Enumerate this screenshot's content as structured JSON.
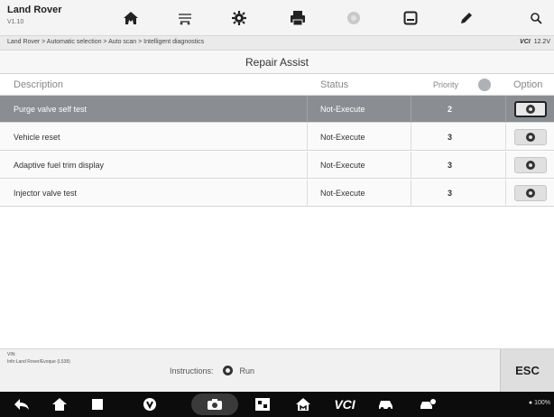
{
  "app": {
    "title": "Land Rover",
    "version": "V1.10"
  },
  "toolbar": {
    "buttons": [
      {
        "name": "home-icon"
      },
      {
        "name": "vehicle-swap-icon"
      },
      {
        "name": "settings-icon"
      },
      {
        "name": "print-icon"
      },
      {
        "name": "help-icon"
      },
      {
        "name": "save-icon"
      },
      {
        "name": "edit-icon"
      },
      {
        "name": "search-icon"
      }
    ]
  },
  "breadcrumb": {
    "path": "Land Rover > Automatic selection > Auto scan > Intelligent diagnostics",
    "vci_label": "VCI",
    "voltage": "12.2V"
  },
  "panel": {
    "title": "Repair Assist"
  },
  "table": {
    "headers": {
      "description": "Description",
      "status": "Status",
      "priority": "Priority",
      "option": "Option"
    },
    "rows": [
      {
        "description": "Purge valve self test",
        "status": "Not-Execute",
        "priority": "2",
        "selected": true
      },
      {
        "description": "Vehicle reset",
        "status": "Not-Execute",
        "priority": "3",
        "selected": false
      },
      {
        "description": "Adaptive fuel trim display",
        "status": "Not-Execute",
        "priority": "3",
        "selected": false
      },
      {
        "description": "Injector valve test",
        "status": "Not-Execute",
        "priority": "3",
        "selected": false
      }
    ]
  },
  "footer": {
    "vin_label": "VIN:",
    "info_text": "Info:Land Rover/Evoque (L538)",
    "instructions_label": "Instructions:",
    "run_label": "Run",
    "esc_label": "ESC"
  },
  "navbar": {
    "vci_text": "VCI",
    "status_text": "100%"
  },
  "colors": {
    "selected_row": "#8a8d92",
    "toolbar_bg": "#f4f4f4",
    "navbar_bg": "#0c0c0c"
  }
}
